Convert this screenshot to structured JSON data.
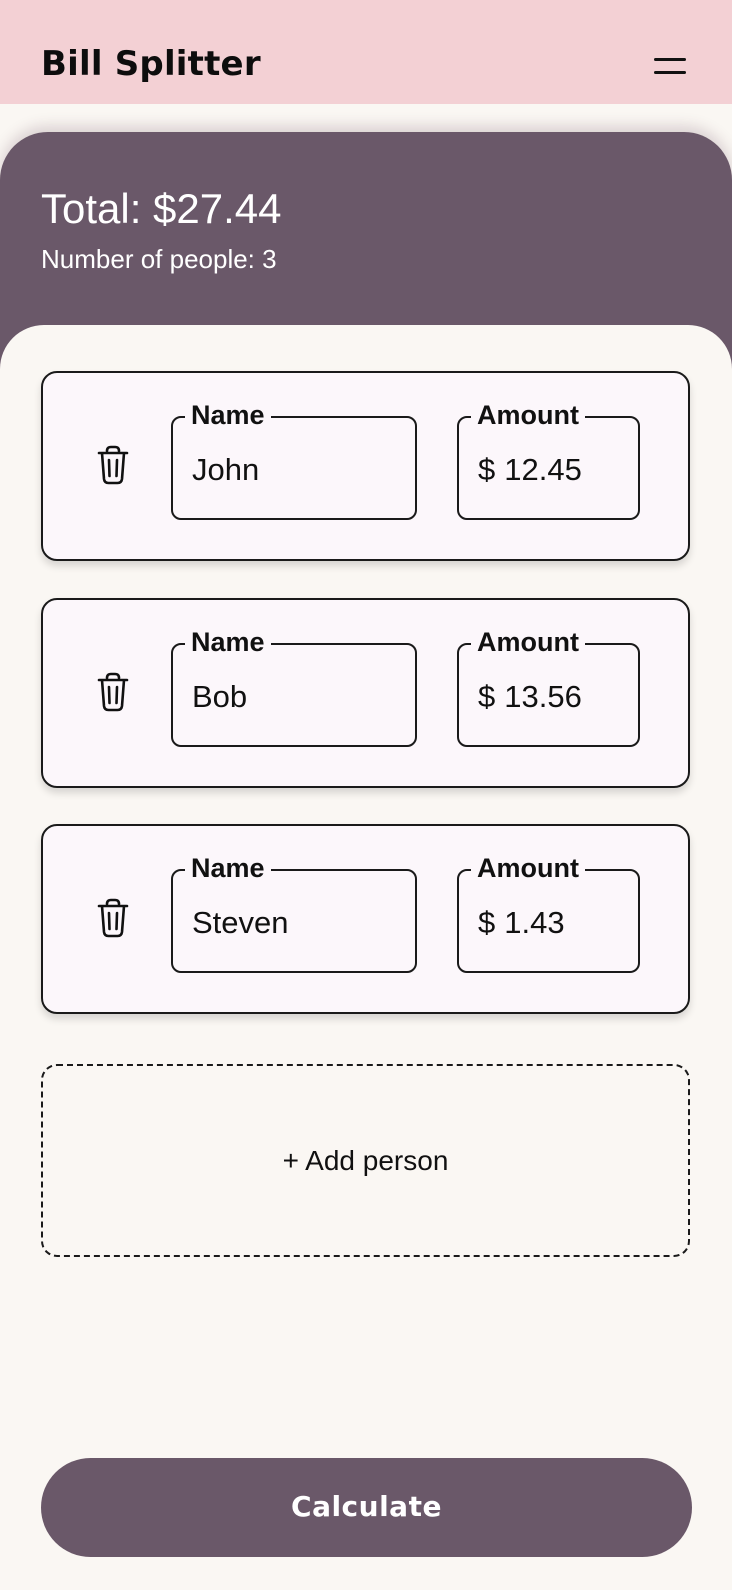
{
  "app_bar": {
    "title": "Bill Splitter",
    "menu_icon": "hamburger-menu-icon",
    "background": "#f3d0d4"
  },
  "summary": {
    "total": "Total: $27.44",
    "people_count": "Number of people: 3",
    "background": "#6a5869"
  },
  "people": [
    {
      "name_label": "Name",
      "name": "John",
      "amount_label": "Amount",
      "currency": "$",
      "amount": "12.45",
      "delete_icon": "trash-icon"
    },
    {
      "name_label": "Name",
      "name": "Bob",
      "amount_label": "Amount",
      "currency": "$",
      "amount": "13.56",
      "delete_icon": "trash-icon"
    },
    {
      "name_label": "Name",
      "name": "Steven",
      "amount_label": "Amount",
      "currency": "$",
      "amount": "1.43",
      "delete_icon": "trash-icon"
    }
  ],
  "add_person": {
    "label": "+ Add person"
  },
  "calculate": {
    "label": "Calculate",
    "background": "#6a5869"
  }
}
